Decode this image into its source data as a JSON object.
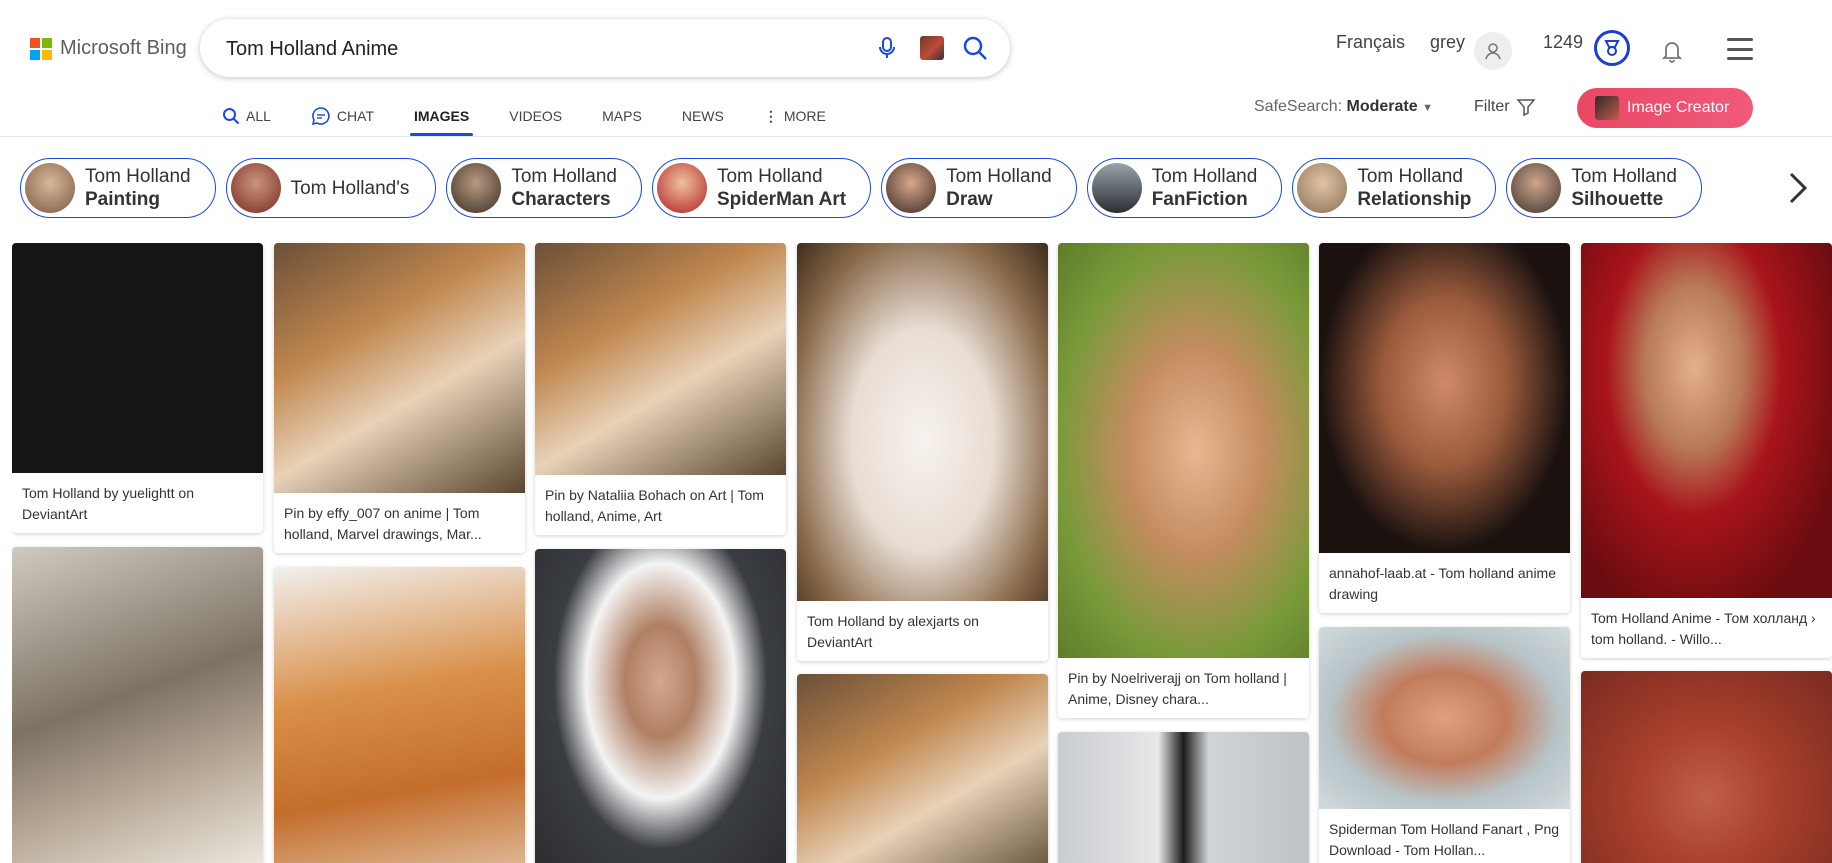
{
  "brand": {
    "name": "Microsoft Bing"
  },
  "search": {
    "query": "Tom Holland Anime"
  },
  "header": {
    "language": "Français",
    "user": "grey",
    "points": "1249"
  },
  "nav": {
    "tabs": [
      {
        "label": "ALL"
      },
      {
        "label": "CHAT"
      },
      {
        "label": "IMAGES"
      },
      {
        "label": "VIDEOS"
      },
      {
        "label": "MAPS"
      },
      {
        "label": "NEWS"
      },
      {
        "label": "MORE"
      }
    ]
  },
  "toolbar": {
    "safesearch_label": "SafeSearch:",
    "safesearch_value": "Moderate",
    "filter_label": "Filter",
    "creator_label": "Image Creator"
  },
  "chips": [
    {
      "line1": "Tom Holland",
      "line2": "Painting"
    },
    {
      "line1": "Tom Holland's",
      "line2": ""
    },
    {
      "line1": "Tom Holland",
      "line2": "Characters"
    },
    {
      "line1": "Tom Holland",
      "line2": "SpiderMan Art"
    },
    {
      "line1": "Tom Holland",
      "line2": "Draw"
    },
    {
      "line1": "Tom Holland",
      "line2": "FanFiction"
    },
    {
      "line1": "Tom Holland",
      "line2": "Relationship"
    },
    {
      "line1": "Tom Holland",
      "line2": "Silhouette"
    }
  ],
  "results": [
    {
      "caption": "Tom Holland by yuelightt on DeviantArt"
    },
    {
      "caption": "Pin by effy_007 on anime | Tom holland, Marvel drawings, Mar..."
    },
    {
      "caption": "Pin by Nataliia Bohach on Art | Tom holland, Anime, Art"
    },
    {
      "caption": "Tom Holland by alexjarts on DeviantArt"
    },
    {
      "caption": "Pin by Noelriverajj on Tom holland | Anime, Disney chara..."
    },
    {
      "caption": "annahof-laab.at - Tom holland anime drawing"
    },
    {
      "caption": "Tom Holland Anime - Том холланд › tom holland. - Willo..."
    },
    {
      "caption": "Spiderman Tom Holland Fanart , Png Download - Tom Hollan..."
    }
  ],
  "colors": {
    "accent": "#174ae4",
    "creator": "#ec4f6e"
  }
}
